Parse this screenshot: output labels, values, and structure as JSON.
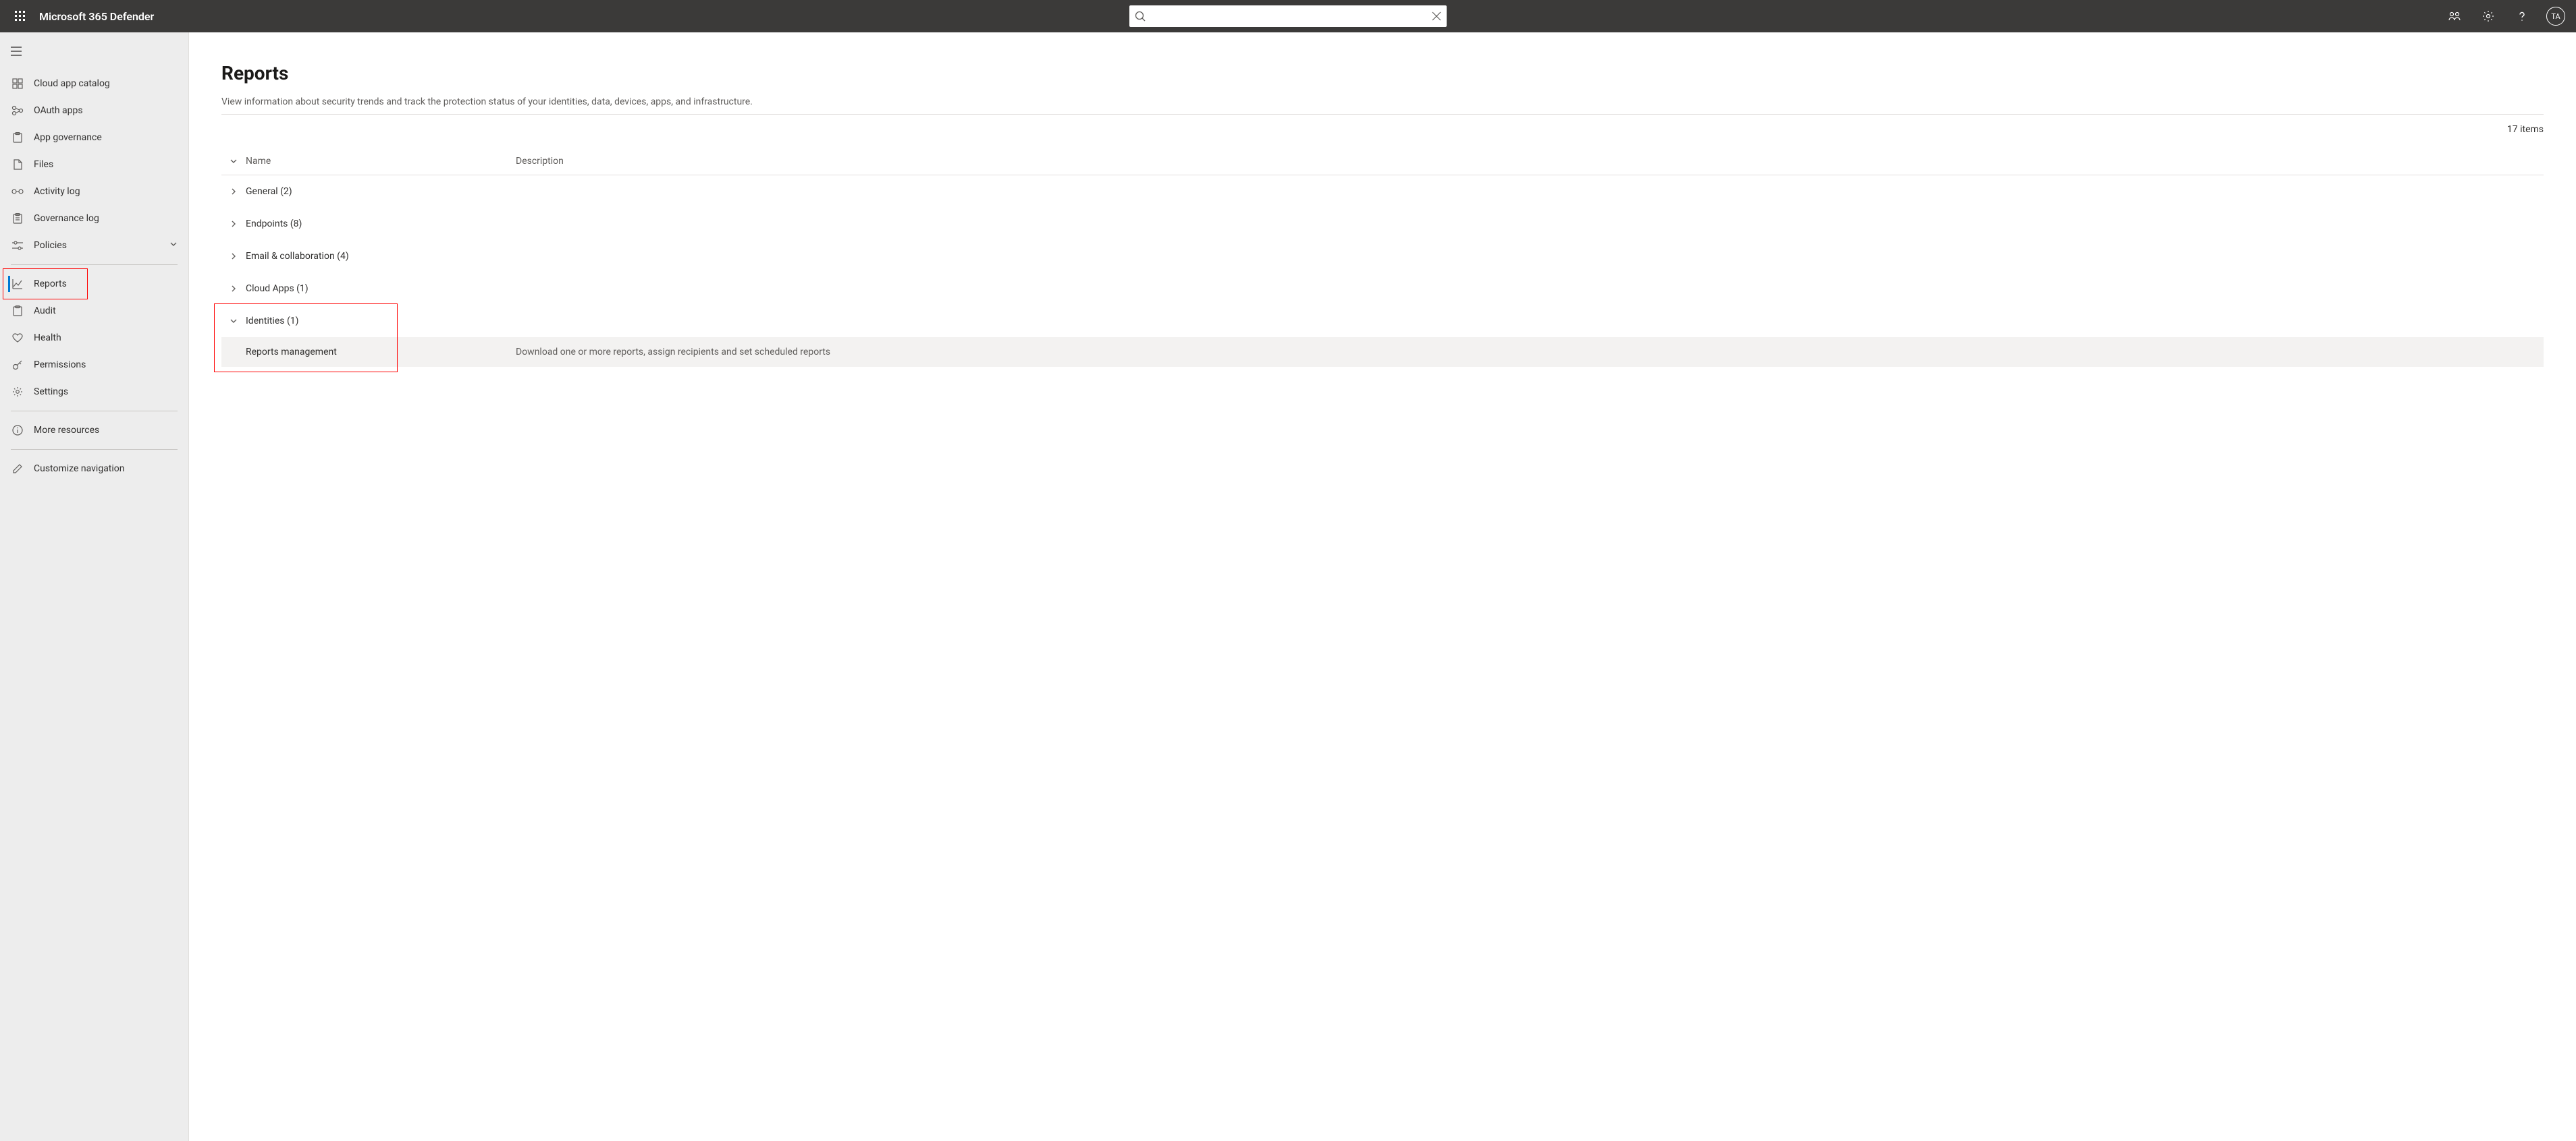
{
  "header": {
    "product_title": "Microsoft 365 Defender",
    "search_placeholder": "",
    "avatar_initials": "TA"
  },
  "sidebar": {
    "items": [
      {
        "icon": "grid-app-icon",
        "label": "Cloud app catalog",
        "active": false,
        "hasChevron": false
      },
      {
        "icon": "oauth-icon",
        "label": "OAuth apps",
        "active": false,
        "hasChevron": false
      },
      {
        "icon": "clipboard-icon",
        "label": "App governance",
        "active": false,
        "hasChevron": false
      },
      {
        "icon": "file-icon",
        "label": "Files",
        "active": false,
        "hasChevron": false
      },
      {
        "icon": "activity-icon",
        "label": "Activity log",
        "active": false,
        "hasChevron": false
      },
      {
        "icon": "clipboard-icon",
        "label": "Governance log",
        "active": false,
        "hasChevron": false
      },
      {
        "icon": "sliders-icon",
        "label": "Policies",
        "active": false,
        "hasChevron": true
      }
    ],
    "reports": {
      "icon": "chart-icon",
      "label": "Reports",
      "active": true
    },
    "lower": [
      {
        "icon": "clipboard-icon",
        "label": "Audit"
      },
      {
        "icon": "heart-icon",
        "label": "Health"
      },
      {
        "icon": "key-icon",
        "label": "Permissions"
      },
      {
        "icon": "gear-icon",
        "label": "Settings"
      }
    ],
    "more": {
      "icon": "info-icon",
      "label": "More resources"
    },
    "customize": {
      "icon": "edit-icon",
      "label": "Customize navigation"
    }
  },
  "main": {
    "title": "Reports",
    "description": "View information about security trends and track the protection status of your identities, data, devices, apps, and infrastructure.",
    "item_count_text": "17 items",
    "columns": {
      "name": "Name",
      "description": "Description"
    },
    "groups": [
      {
        "label": "General (2)",
        "expanded": false
      },
      {
        "label": "Endpoints (8)",
        "expanded": false
      },
      {
        "label": "Email & collaboration (4)",
        "expanded": false
      },
      {
        "label": "Cloud Apps (1)",
        "expanded": false
      },
      {
        "label": "Identities (1)",
        "expanded": true,
        "children": [
          {
            "name": "Reports management",
            "description": "Download one or more reports, assign recipients and set scheduled reports"
          }
        ]
      }
    ]
  }
}
